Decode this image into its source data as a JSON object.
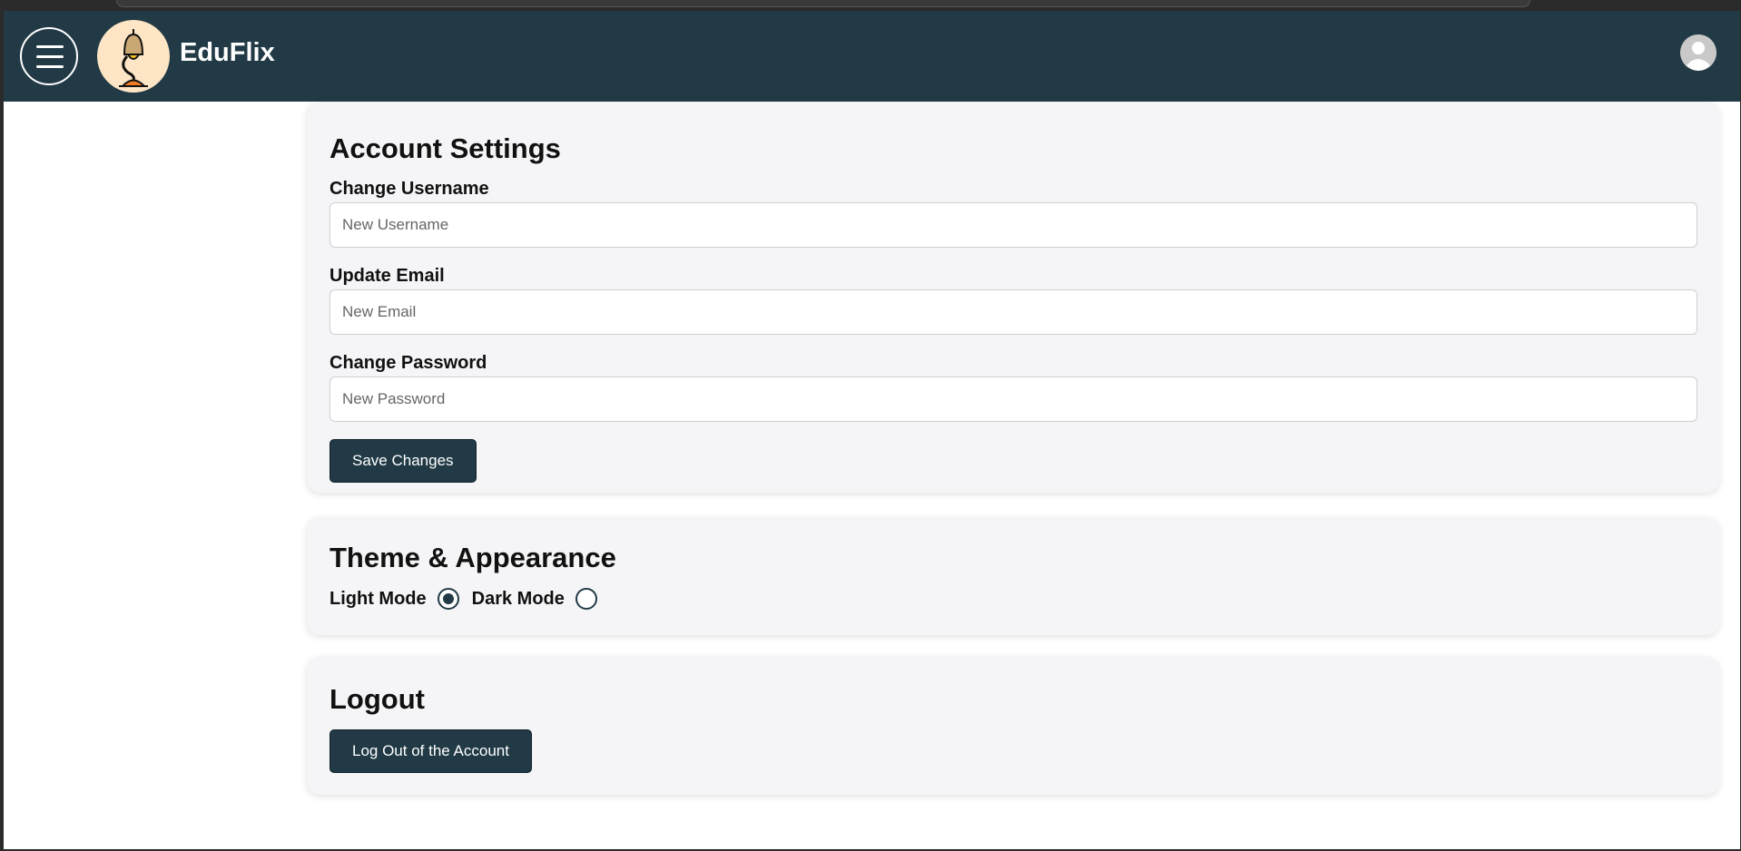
{
  "app": {
    "brand": "EduFlix"
  },
  "icons": {
    "menu": "hamburger-menu-icon",
    "logo": "desk-lamp-icon",
    "avatar": "user-avatar-icon"
  },
  "colors": {
    "header_bg": "#213a45",
    "card_bg": "#f5f5f8",
    "button_bg": "#213a45",
    "logo_bg": "#fde5c6"
  },
  "account_settings": {
    "title": "Account Settings",
    "username": {
      "label": "Change Username",
      "placeholder": "New Username",
      "value": ""
    },
    "email": {
      "label": "Update Email",
      "placeholder": "New Email",
      "value": ""
    },
    "password": {
      "label": "Change Password",
      "placeholder": "New Password",
      "value": ""
    },
    "save_label": "Save Changes"
  },
  "theme": {
    "title": "Theme & Appearance",
    "options": [
      {
        "label": "Light Mode",
        "selected": true
      },
      {
        "label": "Dark Mode",
        "selected": false
      }
    ]
  },
  "logout": {
    "title": "Logout",
    "button_label": "Log Out of the Account"
  }
}
